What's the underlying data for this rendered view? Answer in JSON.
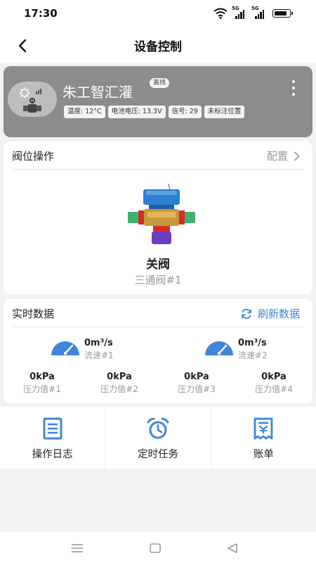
{
  "status_bar": {
    "time": "17:30",
    "signal1_label": "5G",
    "signal2_label": "5G",
    "icons": [
      "wifi-icon",
      "signal-icon",
      "signal-icon",
      "battery-icon"
    ]
  },
  "nav": {
    "title": "设备控制",
    "back_icon": "chevron-left-icon"
  },
  "device": {
    "name": "朱工智汇灌",
    "status_badge": "离线",
    "tags": [
      "温度: 12°C",
      "电池电压: 13.3V",
      "信号: 29",
      "未标注位置"
    ],
    "more_icon": "more-vertical-icon"
  },
  "valve_section": {
    "title": "阀位操作",
    "config_label": "配置",
    "state": "关阀",
    "valve_name": "三通阀#1"
  },
  "realtime_section": {
    "title": "实时数据",
    "refresh_label": "刷新数据",
    "flows": [
      {
        "value": "0m³/s",
        "label": "流速#1"
      },
      {
        "value": "0m³/s",
        "label": "流速#2"
      }
    ],
    "pressures": [
      {
        "value": "0kPa",
        "label": "压力值#1"
      },
      {
        "value": "0kPa",
        "label": "压力值#2"
      },
      {
        "value": "0kPa",
        "label": "压力值#3"
      },
      {
        "value": "0kPa",
        "label": "压力值#4"
      }
    ]
  },
  "actions": [
    {
      "label": "操作日志",
      "icon": "log-icon"
    },
    {
      "label": "定时任务",
      "icon": "alarm-clock-icon"
    },
    {
      "label": "账单",
      "icon": "bill-icon"
    }
  ],
  "colors": {
    "accent": "#3f86d8",
    "device_card_bg": "#8c8c8c",
    "page_bg": "#f2f2f2"
  }
}
